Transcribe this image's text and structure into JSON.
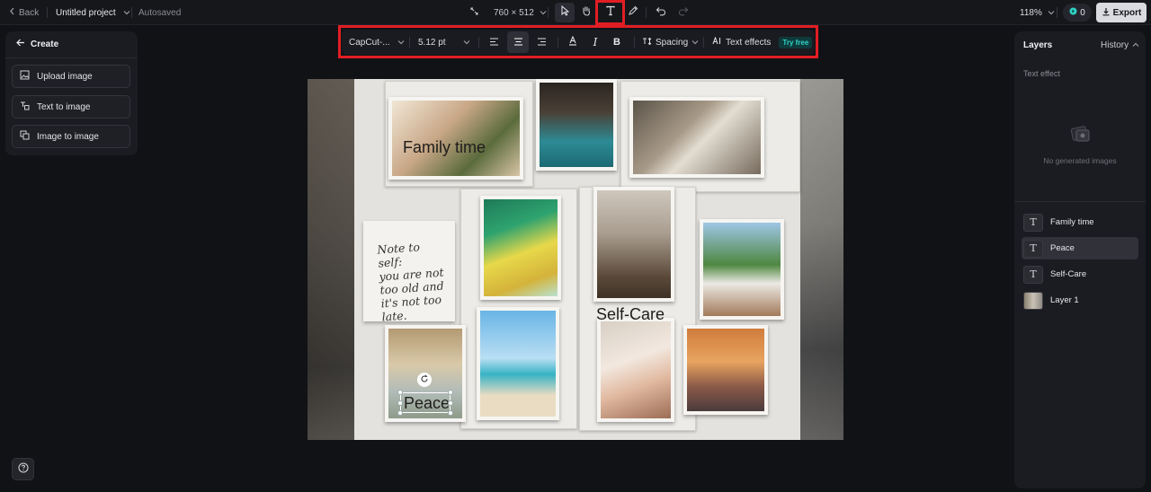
{
  "topbar": {
    "back_label": "Back",
    "project_name": "Untitled project",
    "autosaved": "Autosaved",
    "canvas_size": "760 × 512",
    "zoom": "118%",
    "credits": "0",
    "export_label": "Export"
  },
  "icons": [
    "chevron-left-icon",
    "chevron-down-icon",
    "resize-icon",
    "pointer-icon",
    "hand-icon",
    "text-tool-icon",
    "pen-icon",
    "undo-icon",
    "redo-icon",
    "credit-icon",
    "download-icon",
    "arrow-left-icon",
    "upload-image-icon",
    "text-to-image-icon",
    "image-to-image-icon",
    "help-icon",
    "align-left-icon",
    "align-center-icon",
    "align-right-icon",
    "font-color-icon",
    "italic-icon",
    "bold-icon",
    "spacing-icon",
    "ai-icon",
    "rotate-icon",
    "empty-images-icon"
  ],
  "colors": {
    "highlight_border": "#e11e24",
    "accent_teal": "#2fd3c4",
    "export_bg": "#d9dbe1",
    "panel_bg": "#1b1c21",
    "app_bg": "#111216"
  },
  "create_panel": {
    "title": "Create",
    "buttons": [
      {
        "label": "Upload image"
      },
      {
        "label": "Text to image"
      },
      {
        "label": "Image to image"
      }
    ]
  },
  "format_toolbar": {
    "font": "CapCut-...",
    "font_size": "5.12 pt",
    "text_alignment": "center",
    "italic_label": "I",
    "bold_label": "B",
    "spacing_label": "Spacing",
    "text_effects_label": "Text effects",
    "try_free_badge": "Try free"
  },
  "canvas": {
    "note_text": "Note to self:\nyou are not\ntoo old and\nit's not too\nlate.",
    "texts": [
      {
        "label": "Family time"
      },
      {
        "label": "Self-Care"
      },
      {
        "label": "Peace",
        "selected": true
      }
    ]
  },
  "right_panel": {
    "tabs": [
      "Layers",
      "History"
    ],
    "active_tab": "Layers",
    "section_title": "Text effect",
    "empty_label": "No generated images",
    "layers": [
      {
        "name": "Family time",
        "type": "text"
      },
      {
        "name": "Peace",
        "type": "text",
        "selected": true
      },
      {
        "name": "Self-Care",
        "type": "text"
      },
      {
        "name": "Layer 1",
        "type": "image"
      }
    ]
  }
}
